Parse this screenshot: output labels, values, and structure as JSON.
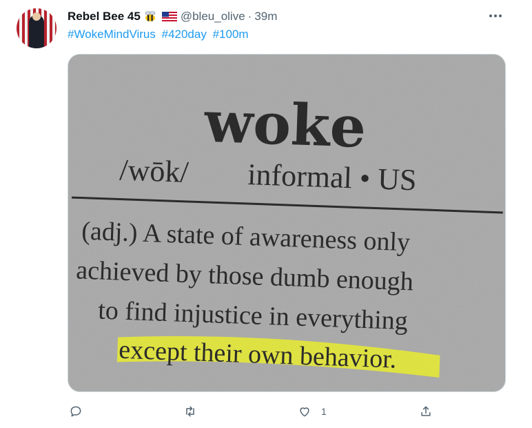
{
  "tweet": {
    "author_name": "Rebel Bee 45",
    "handle": "@bleu_olive",
    "separator": "·",
    "time": "39m",
    "more_label": "•••",
    "hashtags": [
      "#WokeMindVirus",
      "#420day",
      "#100m"
    ]
  },
  "image_text": {
    "headword": "woke",
    "pronunciation": "/wōk/",
    "usage": "informal • US",
    "line1": "(adj.) A state of awareness only",
    "line2": "achieved by those dumb enough",
    "line3": "to find injustice in everything",
    "line4": "except their own behavior."
  },
  "actions": {
    "reply_count": "",
    "retweet_count": "",
    "like_count": "1",
    "share_count": ""
  },
  "colors": {
    "accent": "#1d9bf0",
    "muted": "#536471",
    "highlight": "#e6e832"
  },
  "icons": [
    "bee-emoji",
    "us-flag-emoji",
    "more-icon",
    "reply-icon",
    "retweet-icon",
    "like-icon",
    "share-icon"
  ]
}
